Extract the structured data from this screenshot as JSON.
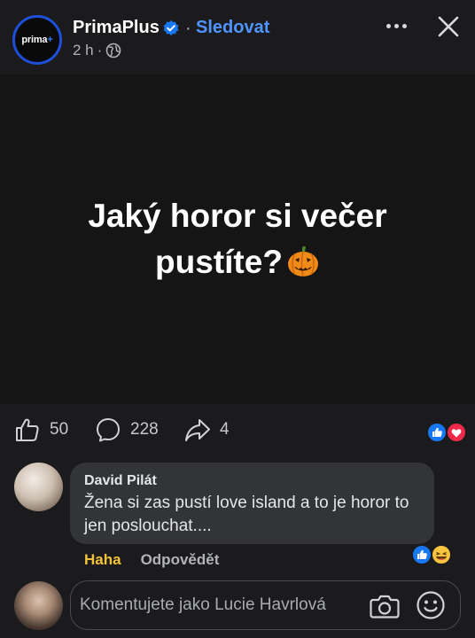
{
  "header": {
    "page_name": "PrimaPlus",
    "avatar_text": "prima",
    "avatar_plus": "+",
    "dot": "·",
    "follow_label": "Sledovat",
    "time": "2 h",
    "meta_dot": "·"
  },
  "post": {
    "text": "Jaký horor si večer pustíte?"
  },
  "actions": {
    "likes": "50",
    "comments": "228",
    "shares": "4"
  },
  "comment": {
    "author": "David Pilát",
    "text": "Žena si zas pustí love island a to je horor to jen poslouchat....",
    "haha_label": "Haha",
    "reply_label": "Odpovědět"
  },
  "composer": {
    "placeholder": "Komentujete jako Lucie Havrlová"
  },
  "colors": {
    "accent": "#4f94ff",
    "haha": "#f5c33b",
    "like_blue": "#1877f2",
    "love_red": "#f02849"
  }
}
